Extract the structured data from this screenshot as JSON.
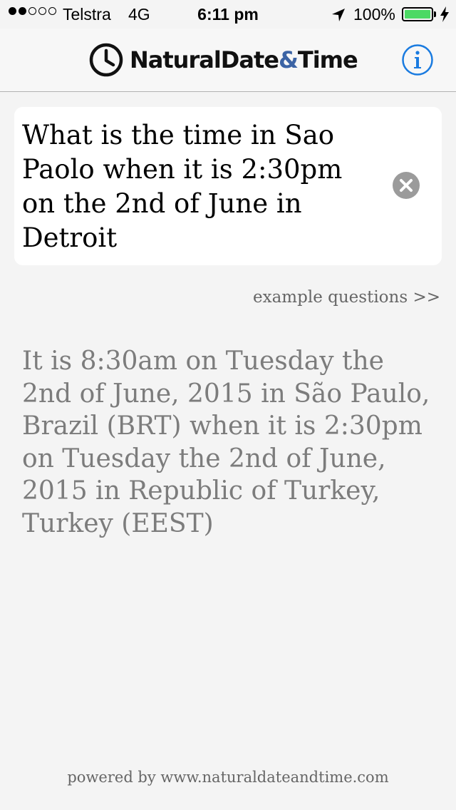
{
  "status_bar": {
    "carrier": "Telstra",
    "network": "4G",
    "time": "6:11 pm",
    "battery": "100%",
    "battery_color": "#4cd964",
    "signal_bars_filled": 2,
    "signal_bars_total": 5,
    "icons": [
      "signal-dots-icon",
      "location-arrow-icon",
      "battery-icon",
      "charging-bolt-icon"
    ]
  },
  "nav": {
    "brand_main": "NaturalDate",
    "brand_amp": "&",
    "brand_end": "Time",
    "brand_icon": "clock-icon",
    "info_icon": "info-icon",
    "accent_color": "#1a7be0"
  },
  "query": {
    "text": "What is the time in Sao Paolo when it is 2:30pm on the 2nd of June in Detroit",
    "clear_icon": "clear-icon"
  },
  "examples_link": "example questions >>",
  "answer": "It is 8:30am on Tuesday the 2nd of June, 2015 in São Paulo, Brazil (BRT) when it is 2:30pm on Tuesday the 2nd of June, 2015 in Republic of Turkey, Turkey (EEST)",
  "footer": "powered by www.naturaldateandtime.com"
}
